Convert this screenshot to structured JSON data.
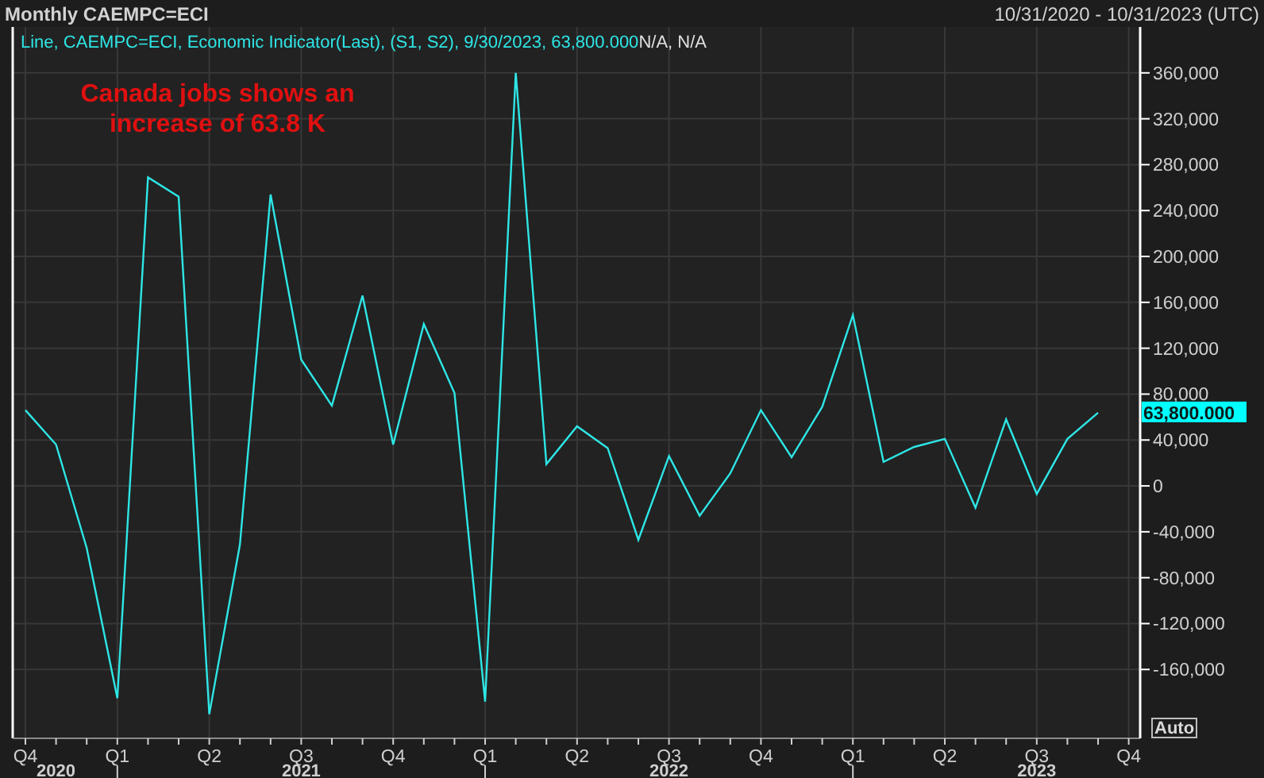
{
  "header": {
    "title": "Monthly CAEMPC=ECI",
    "date_range": "10/31/2020 - 10/31/2023 (UTC)"
  },
  "legend": {
    "text": "Line, CAEMPC=ECI, Economic Indicator(Last), (S1, S2), 9/30/2023, 63,800.000",
    "suffix": "N/A, N/A"
  },
  "annotation": {
    "lines": [
      "Canada jobs shows an",
      "increase of 63.8 K"
    ]
  },
  "last_value_badge": "63,800.000",
  "auto_button": "Auto",
  "years": [
    "2020",
    "2021",
    "2022",
    "2023"
  ],
  "chart_data": {
    "type": "line",
    "categories": [
      "Q4",
      null,
      null,
      "Q1",
      null,
      null,
      "Q2",
      null,
      null,
      "Q3",
      null,
      null,
      "Q4",
      null,
      null,
      "Q1",
      null,
      null,
      "Q2",
      null,
      null,
      "Q3",
      null,
      null,
      "Q4",
      null,
      null,
      "Q1",
      null,
      null,
      "Q2",
      null,
      null,
      "Q3",
      null,
      null,
      "Q4"
    ],
    "series": [
      {
        "color": "#2ee6e6",
        "values": [
          66000,
          36000,
          -54000,
          -185000,
          269000,
          252000,
          -199000,
          -51000,
          254000,
          110000,
          70000,
          166000,
          36000,
          141000,
          81000,
          -188000,
          360000,
          19000,
          52000,
          33000,
          -47000,
          26000,
          -26000,
          11000,
          66000,
          25000,
          69000,
          149000,
          21000,
          34000,
          41000,
          -19000,
          58000,
          -7000,
          41000,
          63800,
          null
        ]
      }
    ],
    "ylim": [
      -220000,
      400000
    ],
    "grid": true,
    "yticks": [
      {
        "value": 360000,
        "label": "360,000"
      },
      {
        "value": 320000,
        "label": "320,000"
      },
      {
        "value": 280000,
        "label": "280,000"
      },
      {
        "value": 240000,
        "label": "240,000"
      },
      {
        "value": 200000,
        "label": "200,000"
      },
      {
        "value": 160000,
        "label": "160,000"
      },
      {
        "value": 120000,
        "label": "120,000"
      },
      {
        "value": 80000,
        "label": "80,000"
      },
      {
        "value": 40000,
        "label": "40,000"
      },
      {
        "value": 0,
        "label": "0"
      },
      {
        "value": -40000,
        "label": "-40,000"
      },
      {
        "value": -80000,
        "label": "-80,000"
      },
      {
        "value": -120000,
        "label": "-120,000"
      },
      {
        "value": -160000,
        "label": "-160,000"
      }
    ]
  }
}
